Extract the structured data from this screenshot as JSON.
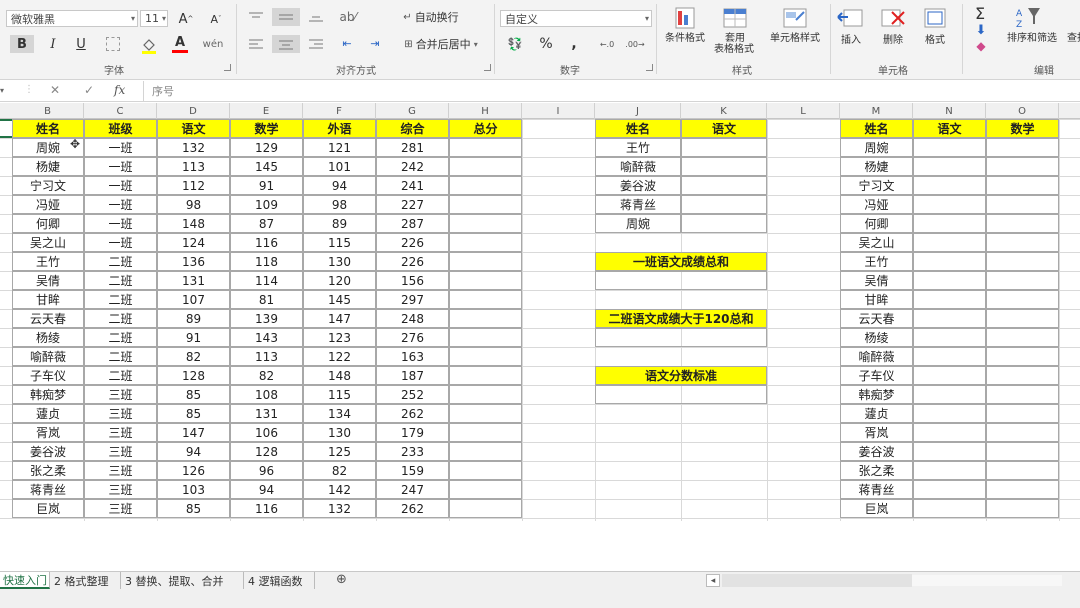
{
  "ribbon": {
    "font_name": "微软雅黑",
    "font_size": "11",
    "number_format": "自定义",
    "wrap_text": "自动换行",
    "merge_center": "合并后居中",
    "cond_format": "条件格式",
    "table_format_1": "套用",
    "table_format_2": "表格格式",
    "cell_style": "单元格样式",
    "insert": "插入",
    "delete": "删除",
    "format": "格式",
    "sort_filter": "排序和筛选",
    "find": "查找",
    "groups": {
      "font": "字体",
      "alignment": "对齐方式",
      "number": "数字",
      "styles": "样式",
      "cells": "单元格",
      "editing": "编辑"
    },
    "bold": "B",
    "italic": "I",
    "underline": "U",
    "font_color_letter": "A",
    "increase_font": "A",
    "decrease_font": "A",
    "percent": "%",
    "comma": ","
  },
  "formula_bar": {
    "cancel": "✕",
    "enter": "✓",
    "fx": "fx",
    "content": "序号"
  },
  "columns": [
    "B",
    "C",
    "D",
    "E",
    "F",
    "G",
    "H",
    "I",
    "J",
    "K",
    "L",
    "M",
    "N",
    "O"
  ],
  "table1": {
    "headers": [
      "姓名",
      "班级",
      "语文",
      "数学",
      "外语",
      "综合",
      "总分"
    ],
    "rows": [
      [
        "周婉",
        "一班",
        "132",
        "129",
        "121",
        "281"
      ],
      [
        "杨婕",
        "一班",
        "113",
        "145",
        "101",
        "242"
      ],
      [
        "宁习文",
        "一班",
        "112",
        "91",
        "94",
        "241"
      ],
      [
        "冯娅",
        "一班",
        "98",
        "109",
        "98",
        "227"
      ],
      [
        "何卿",
        "一班",
        "148",
        "87",
        "89",
        "287"
      ],
      [
        "吴之山",
        "一班",
        "124",
        "116",
        "115",
        "226"
      ],
      [
        "王竹",
        "二班",
        "136",
        "118",
        "130",
        "226"
      ],
      [
        "吴倩",
        "二班",
        "131",
        "114",
        "120",
        "156"
      ],
      [
        "甘眸",
        "二班",
        "107",
        "81",
        "145",
        "297"
      ],
      [
        "云天春",
        "二班",
        "89",
        "139",
        "147",
        "248"
      ],
      [
        "杨绫",
        "二班",
        "91",
        "143",
        "123",
        "276"
      ],
      [
        "喻醉薇",
        "二班",
        "82",
        "113",
        "122",
        "163"
      ],
      [
        "子车仪",
        "二班",
        "128",
        "82",
        "148",
        "187"
      ],
      [
        "韩痴梦",
        "三班",
        "85",
        "108",
        "115",
        "252"
      ],
      [
        "蘧贞",
        "三班",
        "85",
        "131",
        "134",
        "262"
      ],
      [
        "胥岚",
        "三班",
        "147",
        "106",
        "130",
        "179"
      ],
      [
        "姜谷波",
        "三班",
        "94",
        "128",
        "125",
        "233"
      ],
      [
        "张之柔",
        "三班",
        "126",
        "96",
        "82",
        "159"
      ],
      [
        "蒋青丝",
        "三班",
        "103",
        "94",
        "142",
        "247"
      ],
      [
        "巨岚",
        "三班",
        "85",
        "116",
        "132",
        "262"
      ]
    ]
  },
  "table2": {
    "headers": [
      "姓名",
      "语文"
    ],
    "rows": [
      "王竹",
      "喻醉薇",
      "姜谷波",
      "蒋青丝",
      "周婉"
    ],
    "label_class1_sum": "一班语文成绩总和",
    "label_class2_sum": "二班语文成绩大于120总和",
    "label_std": "语文分数标准"
  },
  "table3": {
    "headers": [
      "姓名",
      "语文",
      "数学"
    ],
    "rows": [
      "周婉",
      "杨婕",
      "宁习文",
      "冯娅",
      "何卿",
      "吴之山",
      "王竹",
      "吴倩",
      "甘眸",
      "云天春",
      "杨绫",
      "喻醉薇",
      "子车仪",
      "韩痴梦",
      "蘧贞",
      "胥岚",
      "姜谷波",
      "张之柔",
      "蒋青丝",
      "巨岚"
    ]
  },
  "sheet_tabs": [
    "快速入门",
    "2 格式整理",
    "3 替换、提取、合并",
    "4 逻辑函数"
  ],
  "add_sheet": "⊕",
  "scroll_left": "◂",
  "colors": {
    "header_fill": "#ffff00",
    "active_tab": "#217346",
    "font_color_red": "#ff0000"
  }
}
